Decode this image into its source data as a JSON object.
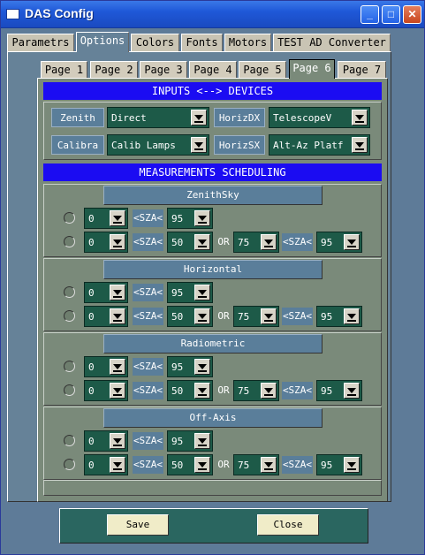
{
  "window": {
    "title": "DAS Config"
  },
  "main_tabs": [
    "Parametrs",
    "Options",
    "Colors",
    "Fonts",
    "Motors",
    "TEST AD Converter"
  ],
  "page_tabs": [
    "Page 1",
    "Page 2",
    "Page 3",
    "Page 4",
    "Page 5",
    "Page 6",
    "Page 7"
  ],
  "inputs_devices": {
    "header": "INPUTS <--> DEVICES",
    "zenith_label": "Zenith",
    "zenith_value": "Direct",
    "horizdx_label": "HorizDX",
    "horizdx_value": "TelescopeV",
    "calibra_label": "Calibra",
    "calibra_value": "Calib Lamps",
    "horizsx_label": "HorizSX",
    "horizsx_value": "Alt-Az Platf"
  },
  "scheduling": {
    "header": "MEASUREMENTS SCHEDULING",
    "sza_label": "<SZA<",
    "or_label": "OR",
    "sections": [
      {
        "title": "ZenithSky",
        "r1_min": "0",
        "r1_max": "95",
        "r2_min": "0",
        "r2_mid": "50",
        "r2_or": "75",
        "r2_max": "95"
      },
      {
        "title": "Horizontal",
        "r1_min": "0",
        "r1_max": "95",
        "r2_min": "0",
        "r2_mid": "50",
        "r2_or": "75",
        "r2_max": "95"
      },
      {
        "title": "Radiometric",
        "r1_min": "0",
        "r1_max": "95",
        "r2_min": "0",
        "r2_mid": "50",
        "r2_or": "75",
        "r2_max": "95"
      },
      {
        "title": "Off-Axis",
        "r1_min": "0",
        "r1_max": "95",
        "r2_min": "0",
        "r2_mid": "50",
        "r2_or": "75",
        "r2_max": "95"
      }
    ]
  },
  "footer": {
    "save_label": "Save",
    "close_label": "Close"
  },
  "colors": {
    "titlebar": "#1f58d8",
    "section_header": "#1b0cf2",
    "combo_bg": "#1d5a48",
    "label_bg": "#5a7e9a",
    "footer_bg": "#2a6660"
  }
}
